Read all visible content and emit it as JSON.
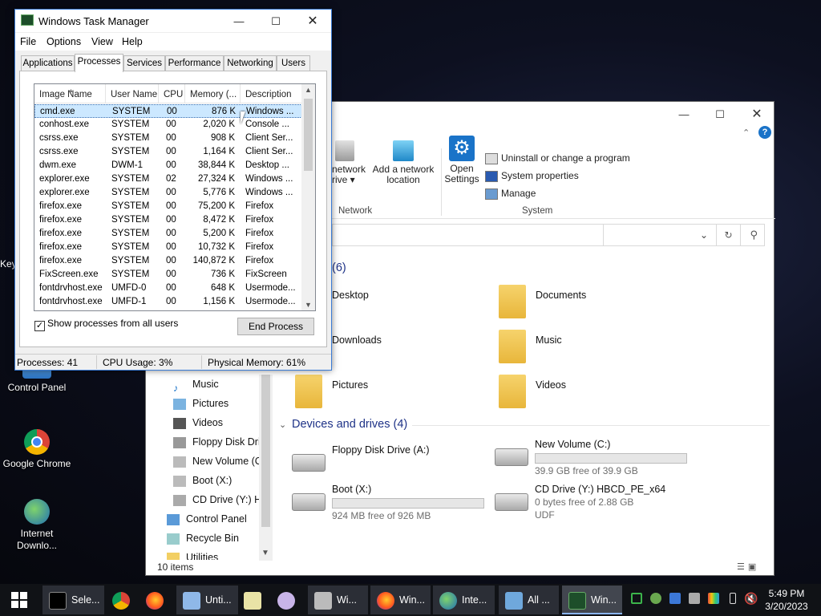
{
  "desktop": {
    "icons": [
      {
        "label": "Control Panel"
      },
      {
        "label": "Google Chrome"
      },
      {
        "label": "Internet Downlo..."
      }
    ],
    "partial_label": "Key"
  },
  "task_manager": {
    "title": "Windows Task Manager",
    "menu": [
      "File",
      "Options",
      "View",
      "Help"
    ],
    "tabs": [
      "Applications",
      "Processes",
      "Services",
      "Performance",
      "Networking",
      "Users"
    ],
    "active_tab": "Processes",
    "columns": [
      "Image Name",
      "User Name",
      "CPU",
      "Memory (...",
      "Description"
    ],
    "processes": [
      {
        "name": "cmd.exe",
        "user": "SYSTEM",
        "cpu": "00",
        "mem": "876 K",
        "desc": "Windows ..."
      },
      {
        "name": "conhost.exe",
        "user": "SYSTEM",
        "cpu": "00",
        "mem": "2,020 K",
        "desc": "Console ..."
      },
      {
        "name": "csrss.exe",
        "user": "SYSTEM",
        "cpu": "00",
        "mem": "908 K",
        "desc": "Client Ser..."
      },
      {
        "name": "csrss.exe",
        "user": "SYSTEM",
        "cpu": "00",
        "mem": "1,164 K",
        "desc": "Client Ser..."
      },
      {
        "name": "dwm.exe",
        "user": "DWM-1",
        "cpu": "00",
        "mem": "38,844 K",
        "desc": "Desktop ..."
      },
      {
        "name": "explorer.exe",
        "user": "SYSTEM",
        "cpu": "02",
        "mem": "27,324 K",
        "desc": "Windows ..."
      },
      {
        "name": "explorer.exe",
        "user": "SYSTEM",
        "cpu": "00",
        "mem": "5,776 K",
        "desc": "Windows ..."
      },
      {
        "name": "firefox.exe",
        "user": "SYSTEM",
        "cpu": "00",
        "mem": "75,200 K",
        "desc": "Firefox"
      },
      {
        "name": "firefox.exe",
        "user": "SYSTEM",
        "cpu": "00",
        "mem": "8,472 K",
        "desc": "Firefox"
      },
      {
        "name": "firefox.exe",
        "user": "SYSTEM",
        "cpu": "00",
        "mem": "5,200 K",
        "desc": "Firefox"
      },
      {
        "name": "firefox.exe",
        "user": "SYSTEM",
        "cpu": "00",
        "mem": "10,732 K",
        "desc": "Firefox"
      },
      {
        "name": "firefox.exe",
        "user": "SYSTEM",
        "cpu": "00",
        "mem": "140,872 K",
        "desc": "Firefox"
      },
      {
        "name": "FixScreen.exe",
        "user": "SYSTEM",
        "cpu": "00",
        "mem": "736 K",
        "desc": "FixScreen"
      },
      {
        "name": "fontdrvhost.exe",
        "user": "UMFD-0",
        "cpu": "00",
        "mem": "648 K",
        "desc": "Usermode..."
      },
      {
        "name": "fontdrvhost.exe",
        "user": "UMFD-1",
        "cpu": "00",
        "mem": "1,156 K",
        "desc": "Usermode..."
      }
    ],
    "show_all_label": "Show processes from all users",
    "show_all_checked": true,
    "end_process_label": "End Process",
    "status": {
      "processes": "Processes: 41",
      "cpu": "CPU Usage: 3%",
      "memory": "Physical Memory: 61%"
    }
  },
  "explorer": {
    "ribbon": {
      "network_drive_label": "network",
      "network_drive_label2": "rive ▾",
      "add_location_label": "Add a network",
      "add_location_label2": "location",
      "network_group": "Network",
      "open_settings": "Open",
      "open_settings2": "Settings",
      "uninstall": "Uninstall or change a program",
      "system_properties": "System properties",
      "manage": "Manage",
      "system_group": "System"
    },
    "folders_count": "(6)",
    "folders": [
      {
        "label": "Desktop"
      },
      {
        "label": "Documents"
      },
      {
        "label": "Downloads"
      },
      {
        "label": "Music"
      },
      {
        "label": "Pictures"
      },
      {
        "label": "Videos"
      }
    ],
    "devices_header": "Devices and drives (4)",
    "drives": [
      {
        "name": "Floppy Disk Drive (A:)"
      },
      {
        "name": "New Volume (C:)",
        "free": "39.9 GB free of 39.9 GB",
        "used_fraction": 0.0
      },
      {
        "name": "Boot (X:)",
        "free": "924 MB free of 926 MB",
        "used_fraction": 0.0
      },
      {
        "name": "CD Drive (Y:) HBCD_PE_x64",
        "free": "0 bytes free of 2.88 GB",
        "fs": "UDF"
      }
    ],
    "nav": [
      {
        "label": "Music"
      },
      {
        "label": "Pictures"
      },
      {
        "label": "Videos"
      },
      {
        "label": "Floppy Disk Dri"
      },
      {
        "label": "New Volume (C"
      },
      {
        "label": "Boot (X:)"
      },
      {
        "label": "CD Drive (Y:) H"
      },
      {
        "label": "Control Panel"
      },
      {
        "label": "Recycle Bin"
      },
      {
        "label": "Utilities"
      }
    ],
    "status": "10 items"
  },
  "taskbar": {
    "items": [
      {
        "label": "Sele..."
      },
      {
        "label": "Unti..."
      },
      {
        "label": "Wi..."
      },
      {
        "label": "Win..."
      },
      {
        "label": "Inte..."
      },
      {
        "label": "All ..."
      },
      {
        "label": "Win..."
      }
    ],
    "time": "5:49 PM",
    "date": "3/20/2023"
  },
  "colors": {
    "accent": "#0078d7",
    "selection": "#cce8ff",
    "section_heading": "#1e3287",
    "drive_bar": "#26a0da"
  }
}
